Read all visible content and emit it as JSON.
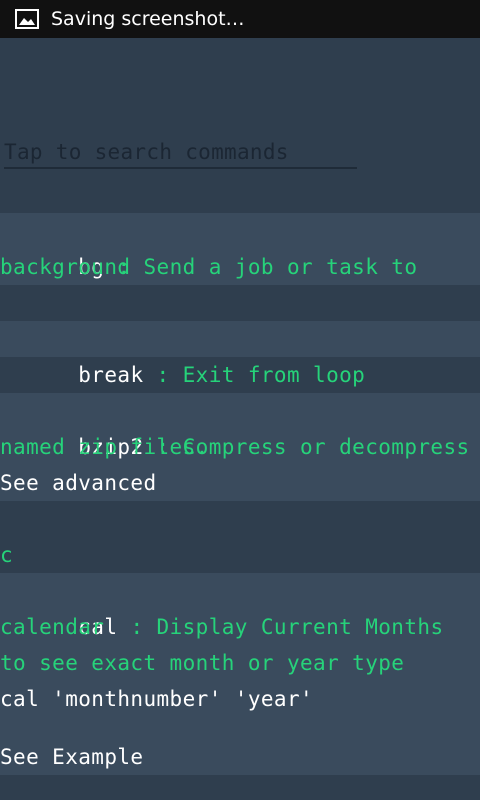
{
  "status_bar": {
    "title": "Saving screenshot…",
    "icon": "image-icon"
  },
  "search": {
    "placeholder": "Tap to  search commands"
  },
  "commands": [
    {
      "name": "bg",
      "desc_line1": " : Send a job or task to",
      "desc_line2": "background"
    },
    {
      "name": "break",
      "desc_line1": " : Exit from loop"
    },
    {
      "name": "bzip2",
      "desc_line1": " : Compress or decompress",
      "desc_line2": "named zip files.",
      "extra_line": "See advanced"
    }
  ],
  "section_header": "c",
  "cal": {
    "name": "cal",
    "desc_line1": " : Display Current Months",
    "desc_line2": "calendar",
    "desc_line3": "to see exact month or year type",
    "usage": "cal 'monthnumber' 'year'",
    "see_example": "See Example"
  },
  "colors": {
    "background": "#2f3e4e",
    "card": "#3a4b5d",
    "accent_green": "#26d37a",
    "status_bar": "#111111"
  }
}
